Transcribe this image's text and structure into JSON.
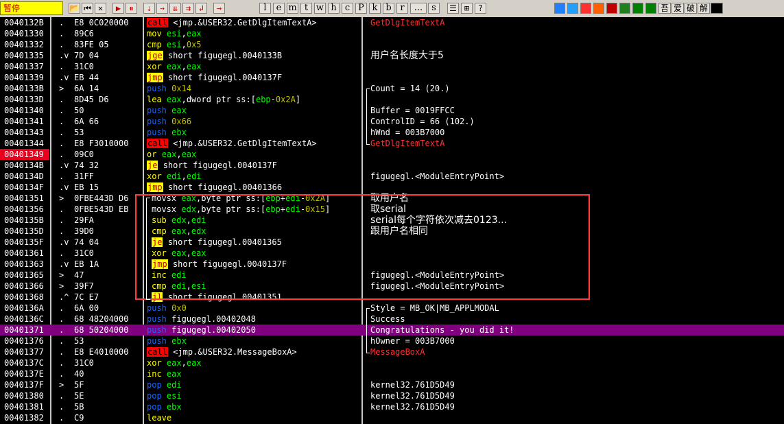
{
  "status_label": "暂停",
  "toolbar": {
    "buttons": [
      {
        "name": "open-icon",
        "glyph": "📂"
      },
      {
        "name": "restart-icon",
        "glyph": "⏮"
      },
      {
        "name": "close-icon",
        "glyph": "✕"
      },
      {
        "name": "run-icon",
        "glyph": "▶"
      },
      {
        "name": "pause-icon",
        "glyph": "⏸"
      },
      {
        "name": "step-into-icon",
        "glyph": "⇣"
      },
      {
        "name": "step-over-icon",
        "glyph": "⇢"
      },
      {
        "name": "trace-into-icon",
        "glyph": "⇊"
      },
      {
        "name": "trace-over-icon",
        "glyph": "⇉"
      },
      {
        "name": "execute-till-return-icon",
        "glyph": "↲"
      },
      {
        "name": "goto-icon",
        "glyph": "→"
      }
    ],
    "letters": [
      "l",
      "e",
      "m",
      "t",
      "w",
      "h",
      "c",
      "P",
      "k",
      "b",
      "r",
      "...",
      "s"
    ],
    "right_icons": [
      {
        "name": "list-icon",
        "glyph": "☰"
      },
      {
        "name": "grid-icon",
        "glyph": "⊞"
      },
      {
        "name": "help-icon",
        "glyph": "?"
      }
    ],
    "plugin_labels": [
      "吾",
      "爱",
      "破",
      "解"
    ]
  },
  "rows": [
    {
      "addr": "0040132B",
      "mark": ".",
      "hex": "E8 0C020000",
      "mn": "call",
      "ops": "<jmp.&USER32.GetDlgItemTextA>",
      "cm": "GetDlgItemTextA",
      "cm_color": "red"
    },
    {
      "addr": "00401330",
      "mark": ".",
      "hex": "89C6",
      "mn": "mov",
      "ops": "esi,eax",
      "cm": ""
    },
    {
      "addr": "00401332",
      "mark": ".",
      "hex": "83FE 05",
      "mn": "cmp",
      "ops": "esi,0x5",
      "cm": ""
    },
    {
      "addr": "00401335",
      "mark": ".v",
      "hex": "7D 04",
      "mn": "jge",
      "ops": "short figugegl.0040133B",
      "cm": "用户名长度大于5",
      "cm_cn": true
    },
    {
      "addr": "00401337",
      "mark": ".",
      "hex": "31C0",
      "mn": "xor",
      "ops": "eax,eax",
      "cm": ""
    },
    {
      "addr": "00401339",
      "mark": ".v",
      "hex": "EB 44",
      "mn": "jmp",
      "ops": "short figugegl.0040137F",
      "cm": ""
    },
    {
      "addr": "0040133B",
      "mark": ">",
      "hex": "6A 14",
      "mn": "push",
      "ops": "0x14",
      "cm": "Count = 14 (20.)"
    },
    {
      "addr": "0040133D",
      "mark": ".",
      "hex": "8D45 D6",
      "mn": "lea",
      "ops": "eax,dword ptr ss:[ebp-0x2A]",
      "cm": ""
    },
    {
      "addr": "00401340",
      "mark": ".",
      "hex": "50",
      "mn": "push",
      "ops": "eax",
      "cm": "Buffer = 0019FFCC"
    },
    {
      "addr": "00401341",
      "mark": ".",
      "hex": "6A 66",
      "mn": "push",
      "ops": "0x66",
      "cm": "ControlID = 66 (102.)"
    },
    {
      "addr": "00401343",
      "mark": ".",
      "hex": "53",
      "mn": "push",
      "ops": "ebx",
      "cm": "hWnd = 003B7000"
    },
    {
      "addr": "00401344",
      "mark": ".",
      "hex": "E8 F3010000",
      "mn": "call",
      "ops": "<jmp.&USER32.GetDlgItemTextA>",
      "cm": "GetDlgItemTextA",
      "cm_color": "red"
    },
    {
      "addr": "00401349",
      "mark": ".",
      "hex": "09C0",
      "mn": "or",
      "ops": "eax,eax",
      "cm": "",
      "selected": true
    },
    {
      "addr": "0040134B",
      "mark": ".v",
      "hex": "74 32",
      "mn": "je",
      "ops": "short figugegl.0040137F",
      "cm": ""
    },
    {
      "addr": "0040134D",
      "mark": ".",
      "hex": "31FF",
      "mn": "xor",
      "ops": "edi,edi",
      "cm": "figugegl.<ModuleEntryPoint>"
    },
    {
      "addr": "0040134F",
      "mark": ".v",
      "hex": "EB 15",
      "mn": "jmp",
      "ops": "short figugegl.00401366",
      "cm": ""
    },
    {
      "addr": "00401351",
      "mark": ">",
      "hex": "0FBE443D D6",
      "mn": "movsx",
      "ops": "eax,byte ptr ss:[ebp+edi-0x2A]",
      "cm": "取用户名",
      "cm_cn": true
    },
    {
      "addr": "00401356",
      "mark": ".",
      "hex": "0FBE543D EB",
      "mn": "movsx",
      "ops": "edx,byte ptr ss:[ebp+edi-0x15]",
      "cm": "取serial",
      "cm_cn": true
    },
    {
      "addr": "0040135B",
      "mark": ".",
      "hex": "29FA",
      "mn": "sub",
      "ops": "edx,edi",
      "cm": "serial每个字符依次减去0123...",
      "cm_cn": true
    },
    {
      "addr": "0040135D",
      "mark": ".",
      "hex": "39D0",
      "mn": "cmp",
      "ops": "eax,edx",
      "cm": "跟用户名相同",
      "cm_cn": true
    },
    {
      "addr": "0040135F",
      "mark": ".v",
      "hex": "74 04",
      "mn": "je",
      "ops": "short figugegl.00401365",
      "cm": ""
    },
    {
      "addr": "00401361",
      "mark": ".",
      "hex": "31C0",
      "mn": "xor",
      "ops": "eax,eax",
      "cm": ""
    },
    {
      "addr": "00401363",
      "mark": ".v",
      "hex": "EB 1A",
      "mn": "jmp",
      "ops": "short figugegl.0040137F",
      "cm": ""
    },
    {
      "addr": "00401365",
      "mark": ">",
      "hex": "47",
      "mn": "inc",
      "ops": "edi",
      "cm": "figugegl.<ModuleEntryPoint>"
    },
    {
      "addr": "00401366",
      "mark": ">",
      "hex": "39F7",
      "mn": "cmp",
      "ops": "edi,esi",
      "cm": "figugegl.<ModuleEntryPoint>"
    },
    {
      "addr": "00401368",
      "mark": ".^",
      "hex": "7C E7",
      "mn": "jl",
      "ops": "short figugegl.00401351",
      "cm": ""
    },
    {
      "addr": "0040136A",
      "mark": ".",
      "hex": "6A 00",
      "mn": "push",
      "ops": "0x0",
      "cm": "Style = MB_OK|MB_APPLMODAL"
    },
    {
      "addr": "0040136C",
      "mark": ".",
      "hex": "68 48204000",
      "mn": "push",
      "ops": "figugegl.00402048",
      "cm": "Success"
    },
    {
      "addr": "00401371",
      "mark": ".",
      "hex": "68 50204000",
      "mn": "push",
      "ops": "figugegl.00402050",
      "cm": "Congratulations - you did it!",
      "eip": true
    },
    {
      "addr": "00401376",
      "mark": ".",
      "hex": "53",
      "mn": "push",
      "ops": "ebx",
      "cm": "hOwner = 003B7000"
    },
    {
      "addr": "00401377",
      "mark": ".",
      "hex": "E8 E4010000",
      "mn": "call",
      "ops": "<jmp.&USER32.MessageBoxA>",
      "cm": "MessageBoxA",
      "cm_color": "red"
    },
    {
      "addr": "0040137C",
      "mark": ".",
      "hex": "31C0",
      "mn": "xor",
      "ops": "eax,eax",
      "cm": ""
    },
    {
      "addr": "0040137E",
      "mark": ".",
      "hex": "40",
      "mn": "inc",
      "ops": "eax",
      "cm": ""
    },
    {
      "addr": "0040137F",
      "mark": ">",
      "hex": "5F",
      "mn": "pop",
      "ops": "edi",
      "cm": "kernel32.761D5D49"
    },
    {
      "addr": "00401380",
      "mark": ".",
      "hex": "5E",
      "mn": "pop",
      "ops": "esi",
      "cm": "kernel32.761D5D49"
    },
    {
      "addr": "00401381",
      "mark": ".",
      "hex": "5B",
      "mn": "pop",
      "ops": "ebx",
      "cm": "kernel32.761D5D49"
    },
    {
      "addr": "00401382",
      "mark": ".",
      "hex": "C9",
      "mn": "leave",
      "ops": "",
      "cm": ""
    }
  ],
  "colors": {
    "background": "#000000",
    "toolbar": "#d4d0c8",
    "selected_address": "#e8001c",
    "eip_row": "#800080",
    "highlight_box": "#ff3b3b"
  }
}
